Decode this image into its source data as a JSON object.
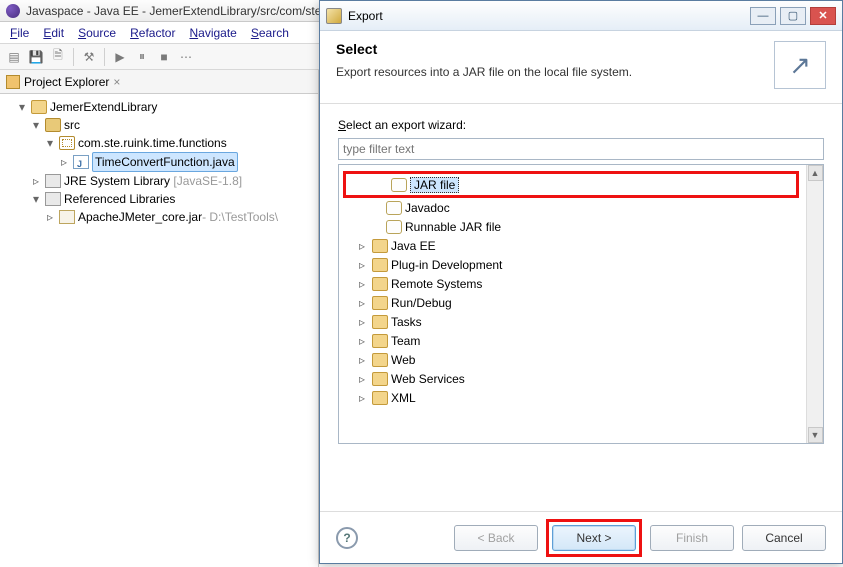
{
  "eclipse": {
    "title": "Javaspace - Java EE - JemerExtendLibrary/src/com/ste/ruink/time/functions/TimeConvertFunction.java - Eclipse",
    "menus": [
      "File",
      "Edit",
      "Source",
      "Refactor",
      "Navigate",
      "Search"
    ]
  },
  "projectExplorer": {
    "tabLabel": "Project Explorer",
    "project": "JemerExtendLibrary",
    "src": "src",
    "package": "com.ste.ruink.time.functions",
    "javaFile": "TimeConvertFunction.java",
    "jre": "JRE System Library",
    "jreEnv": "[JavaSE-1.8]",
    "refLib": "Referenced Libraries",
    "jar": "ApacheJMeter_core.jar",
    "jarPath": " - D:\\TestTools\\"
  },
  "dialog": {
    "title": "Export",
    "headerTitle": "Select",
    "headerDesc": "Export resources into a JAR file on the local file system.",
    "wizardLabel": "Select an export wizard:",
    "filterPlaceholder": "type filter text",
    "tree": {
      "jarFile": "JAR file",
      "javadoc": "Javadoc",
      "runnableJar": "Runnable JAR file",
      "categories": [
        "Java EE",
        "Plug-in Development",
        "Remote Systems",
        "Run/Debug",
        "Tasks",
        "Team",
        "Web",
        "Web Services",
        "XML"
      ]
    },
    "buttons": {
      "back": "< Back",
      "next": "Next >",
      "finish": "Finish",
      "cancel": "Cancel"
    }
  }
}
